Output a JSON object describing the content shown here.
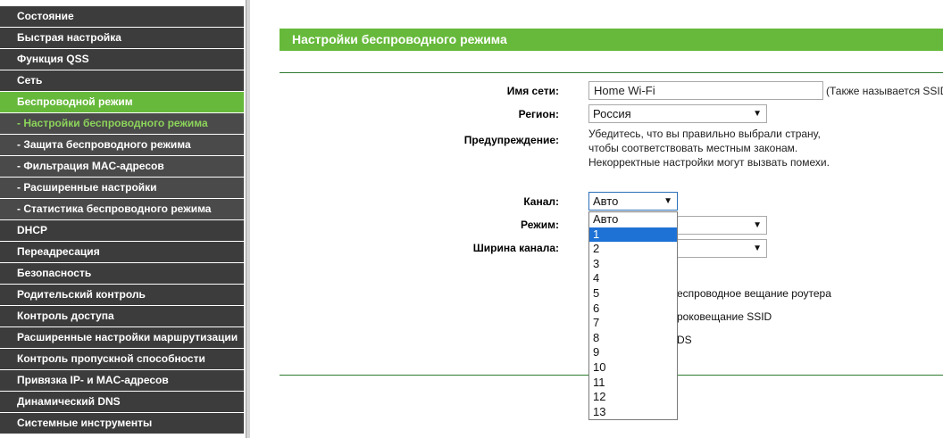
{
  "sidebar": {
    "items": [
      {
        "label": "Состояние"
      },
      {
        "label": "Быстрая настройка"
      },
      {
        "label": "Функция QSS"
      },
      {
        "label": "Сеть"
      },
      {
        "label": "Беспроводной режим"
      },
      {
        "label": "- Настройки беспроводного режима"
      },
      {
        "label": "- Защита беспроводного режима"
      },
      {
        "label": "- Фильтрация MAC-адресов"
      },
      {
        "label": "- Расширенные настройки"
      },
      {
        "label": "- Статистика беспроводного режима"
      },
      {
        "label": "DHCP"
      },
      {
        "label": "Переадресация"
      },
      {
        "label": "Безопасность"
      },
      {
        "label": "Родительский контроль"
      },
      {
        "label": "Контроль доступа"
      },
      {
        "label": "Расширенные настройки маршрутизации"
      },
      {
        "label": "Контроль пропускной способности"
      },
      {
        "label": "Привязка IP- и MAC-адресов"
      },
      {
        "label": "Динамический DNS"
      },
      {
        "label": "Системные инструменты"
      }
    ]
  },
  "main": {
    "title": "Настройки беспроводного режима",
    "ssid": {
      "label": "Имя сети:",
      "value": "Home Wi-Fi",
      "note": "(Также называется SSID"
    },
    "region": {
      "label": "Регион:",
      "value": "Россия"
    },
    "warning": {
      "label": "Предупреждение:",
      "lines": [
        "Убедитесь, что вы правильно выбрали страну,",
        "чтобы соответствовать местным законам.",
        "Некорректные настройки могут вызвать помехи."
      ]
    },
    "channel": {
      "label": "Канал:",
      "value": "Авто",
      "options": [
        "Авто",
        "1",
        "2",
        "3",
        "4",
        "5",
        "6",
        "7",
        "8",
        "9",
        "10",
        "11",
        "12",
        "13"
      ],
      "highlighted": "1"
    },
    "mode": {
      "label": "Режим:"
    },
    "width": {
      "label": "Ширина канала:"
    },
    "checkboxes": {
      "broadcast": "еспроводное вещание роутера",
      "ssid_broadcast": "роковещание SSID",
      "wds": "DS"
    }
  },
  "colors": {
    "accent": "#66b93a",
    "sidebar_bg": "#3c3c3c",
    "highlight": "#1e72d6"
  }
}
